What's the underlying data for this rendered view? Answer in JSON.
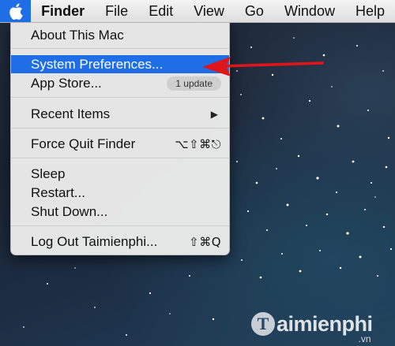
{
  "menubar": {
    "apple_icon": "apple-logo",
    "items": [
      "Finder",
      "File",
      "Edit",
      "View",
      "Go",
      "Window",
      "Help"
    ]
  },
  "apple_menu": {
    "about": "About This Mac",
    "system_preferences": "System Preferences...",
    "app_store": "App Store...",
    "app_store_badge": "1 update",
    "recent_items": "Recent Items",
    "force_quit": "Force Quit Finder",
    "force_quit_shortcut": "⌥⇧⌘⎋",
    "sleep": "Sleep",
    "restart": "Restart...",
    "shut_down": "Shut Down...",
    "log_out": "Log Out Taimienphi...",
    "log_out_shortcut": "⇧⌘Q"
  },
  "watermark": {
    "logo_letter": "T",
    "name": "aimienphi",
    "suffix": ".vn"
  },
  "colors": {
    "selection": "#1f6ee5",
    "arrow": "#e0141b"
  }
}
